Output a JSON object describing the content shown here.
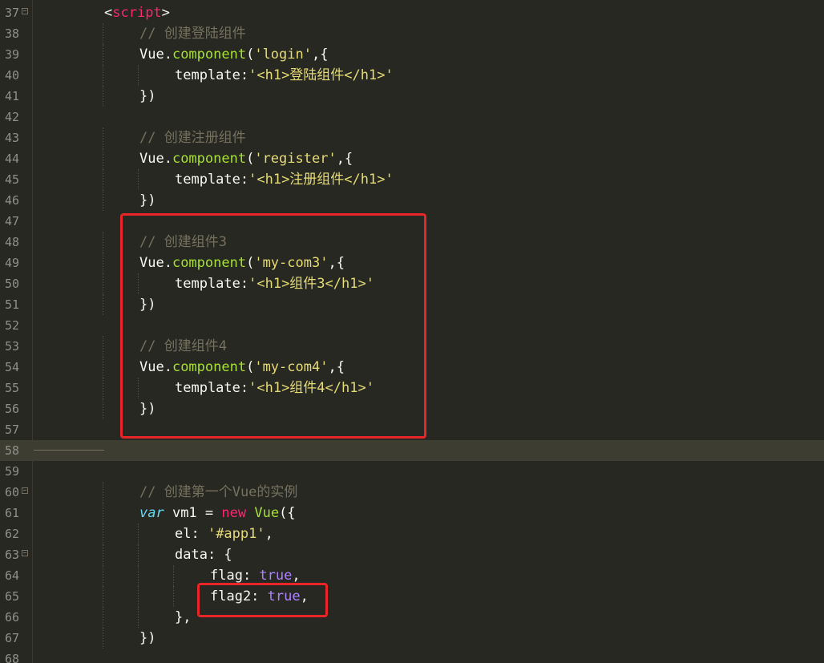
{
  "editor": {
    "lines": [
      {
        "num": "37",
        "tokens": [
          {
            "t": "<",
            "c": "t-pun"
          },
          {
            "t": "script",
            "c": "t-tag"
          },
          {
            "t": ">",
            "c": "t-pun"
          }
        ]
      },
      {
        "num": "38",
        "tokens": [
          {
            "t": "// 创建登陆组件",
            "c": "t-com"
          }
        ]
      },
      {
        "num": "39",
        "tokens": [
          {
            "t": "Vue.",
            "c": "t-pun"
          },
          {
            "t": "component",
            "c": "t-fn"
          },
          {
            "t": "(",
            "c": "t-pun"
          },
          {
            "t": "'login'",
            "c": "t-str"
          },
          {
            "t": ",{",
            "c": "t-pun"
          }
        ]
      },
      {
        "num": "40",
        "tokens": [
          {
            "t": "template:",
            "c": "t-pun"
          },
          {
            "t": "'<h1>登陆组件</h1>'",
            "c": "t-str"
          }
        ]
      },
      {
        "num": "41",
        "tokens": [
          {
            "t": "})",
            "c": "t-pun"
          }
        ]
      },
      {
        "num": "42",
        "tokens": []
      },
      {
        "num": "43",
        "tokens": [
          {
            "t": "// 创建注册组件",
            "c": "t-com"
          }
        ]
      },
      {
        "num": "44",
        "tokens": [
          {
            "t": "Vue.",
            "c": "t-pun"
          },
          {
            "t": "component",
            "c": "t-fn"
          },
          {
            "t": "(",
            "c": "t-pun"
          },
          {
            "t": "'register'",
            "c": "t-str"
          },
          {
            "t": ",{",
            "c": "t-pun"
          }
        ]
      },
      {
        "num": "45",
        "tokens": [
          {
            "t": "template:",
            "c": "t-pun"
          },
          {
            "t": "'<h1>注册组件</h1>'",
            "c": "t-str"
          }
        ]
      },
      {
        "num": "46",
        "tokens": [
          {
            "t": "})",
            "c": "t-pun"
          }
        ]
      },
      {
        "num": "47",
        "tokens": []
      },
      {
        "num": "48",
        "tokens": [
          {
            "t": "// 创建组件3",
            "c": "t-com"
          }
        ]
      },
      {
        "num": "49",
        "tokens": [
          {
            "t": "Vue.",
            "c": "t-pun"
          },
          {
            "t": "component",
            "c": "t-fn"
          },
          {
            "t": "(",
            "c": "t-pun"
          },
          {
            "t": "'my-com3'",
            "c": "t-str"
          },
          {
            "t": ",{",
            "c": "t-pun"
          }
        ]
      },
      {
        "num": "50",
        "tokens": [
          {
            "t": "template:",
            "c": "t-pun"
          },
          {
            "t": "'<h1>组件3</h1>'",
            "c": "t-str"
          }
        ]
      },
      {
        "num": "51",
        "tokens": [
          {
            "t": "})",
            "c": "t-pun"
          }
        ]
      },
      {
        "num": "52",
        "tokens": []
      },
      {
        "num": "53",
        "tokens": [
          {
            "t": "// 创建组件4",
            "c": "t-com"
          }
        ]
      },
      {
        "num": "54",
        "tokens": [
          {
            "t": "Vue.",
            "c": "t-pun"
          },
          {
            "t": "component",
            "c": "t-fn"
          },
          {
            "t": "(",
            "c": "t-pun"
          },
          {
            "t": "'my-com4'",
            "c": "t-str"
          },
          {
            "t": ",{",
            "c": "t-pun"
          }
        ]
      },
      {
        "num": "55",
        "tokens": [
          {
            "t": "template:",
            "c": "t-pun"
          },
          {
            "t": "'<h1>组件4</h1>'",
            "c": "t-str"
          }
        ]
      },
      {
        "num": "56",
        "tokens": [
          {
            "t": "})",
            "c": "t-pun"
          }
        ]
      },
      {
        "num": "57",
        "tokens": []
      },
      {
        "num": "58",
        "tokens": []
      },
      {
        "num": "59",
        "tokens": []
      },
      {
        "num": "60",
        "tokens": [
          {
            "t": "// 创建第一个Vue的实例",
            "c": "t-com"
          }
        ]
      },
      {
        "num": "61",
        "tokens": [
          {
            "t": "var",
            "c": "t-kw"
          },
          {
            "t": " vm1 = ",
            "c": "t-pun"
          },
          {
            "t": "new",
            "c": "t-new"
          },
          {
            "t": " ",
            "c": "t-pun"
          },
          {
            "t": "Vue",
            "c": "t-fn"
          },
          {
            "t": "({",
            "c": "t-pun"
          }
        ]
      },
      {
        "num": "62",
        "tokens": [
          {
            "t": "el: ",
            "c": "t-pun"
          },
          {
            "t": "'#app1'",
            "c": "t-str"
          },
          {
            "t": ",",
            "c": "t-pun"
          }
        ]
      },
      {
        "num": "63",
        "tokens": [
          {
            "t": "data: {",
            "c": "t-pun"
          }
        ]
      },
      {
        "num": "64",
        "tokens": [
          {
            "t": "flag: ",
            "c": "t-pun"
          },
          {
            "t": "true",
            "c": "t-bool"
          },
          {
            "t": ",",
            "c": "t-pun"
          }
        ]
      },
      {
        "num": "65",
        "tokens": [
          {
            "t": "flag2: ",
            "c": "t-pun"
          },
          {
            "t": "true",
            "c": "t-bool"
          },
          {
            "t": ",",
            "c": "t-pun"
          }
        ]
      },
      {
        "num": "66",
        "tokens": [
          {
            "t": "},",
            "c": "t-pun"
          }
        ]
      },
      {
        "num": "67",
        "tokens": [
          {
            "t": "})",
            "c": "t-pun"
          }
        ]
      },
      {
        "num": "68",
        "tokens": []
      }
    ]
  },
  "colors": {
    "background": "#272822",
    "current_line": "#3e3d32",
    "highlight_box": "#e8262a"
  }
}
